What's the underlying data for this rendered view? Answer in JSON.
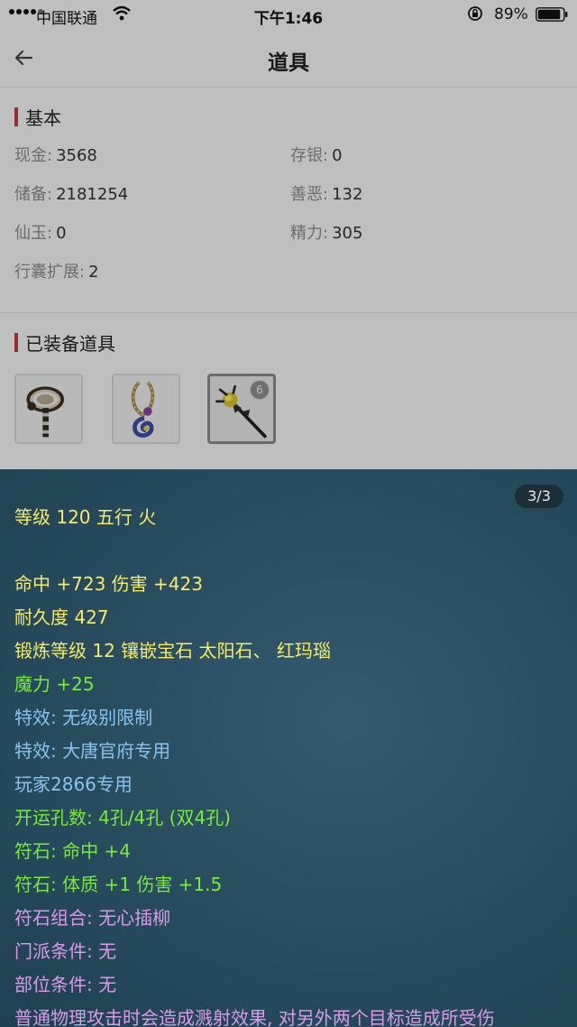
{
  "status_bar": {
    "carrier": "中国联通",
    "time": "下午1:46",
    "battery": "89%"
  },
  "nav": {
    "title": "道具",
    "back_icon": "arrow-left-icon"
  },
  "basic": {
    "section_title": "基本",
    "items": [
      {
        "label": "现金:",
        "value": "3568"
      },
      {
        "label": "存银:",
        "value": "0"
      },
      {
        "label": "储备:",
        "value": "2181254"
      },
      {
        "label": "善恶:",
        "value": "132"
      },
      {
        "label": "仙玉:",
        "value": "0"
      },
      {
        "label": "精力:",
        "value": "305"
      },
      {
        "label": "行囊扩展:",
        "value": "2"
      }
    ]
  },
  "equipped": {
    "section_title": "已装备道具",
    "items": [
      {
        "icon": "staff-icon"
      },
      {
        "icon": "necklace-icon"
      },
      {
        "icon": "weapon-icon",
        "badge": "6",
        "selected": true
      }
    ]
  },
  "tooltip": {
    "page_counter": "3/3",
    "lines": [
      {
        "text": "等级 120 五行 火",
        "color": "#f3ec6c"
      },
      {
        "text": "命中 +723 伤害 +423",
        "color": "#f3ec6c"
      },
      {
        "text": "耐久度 427",
        "color": "#f3ec6c"
      },
      {
        "text": "锻炼等级 12 镶嵌宝石 太阳石、 红玛瑙",
        "color": "#f3ec6c"
      },
      {
        "text": "魔力 +25",
        "color": "#7bea3c"
      },
      {
        "text": "特效: 无级别限制",
        "color": "#8cc3ea"
      },
      {
        "text": "特效: 大唐官府专用",
        "color": "#8cc3ea"
      },
      {
        "text": "玩家2866专用",
        "color": "#8cc3ea"
      },
      {
        "text": "开运孔数: 4孔/4孔 (双4孔)",
        "color": "#7bea3c"
      },
      {
        "text": "符石: 命中 +4",
        "color": "#7bea3c"
      },
      {
        "text": "符石: 体质 +1 伤害 +1.5",
        "color": "#7bea3c"
      },
      {
        "text": "符石组合: 无心插柳",
        "color": "#d99be6"
      },
      {
        "text": "门派条件: 无",
        "color": "#d99be6"
      },
      {
        "text": "部位条件: 无",
        "color": "#d99be6"
      },
      {
        "text": "普通物理攻击时会造成溅射效果, 对另外两个目标造成所受伤",
        "color": "#d99be6"
      }
    ]
  }
}
